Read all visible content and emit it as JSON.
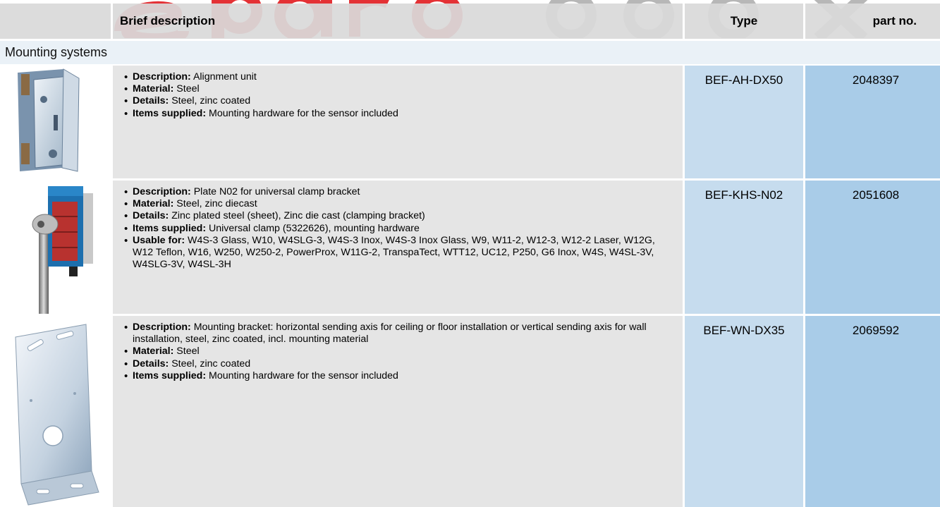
{
  "colors": {
    "header_bg": "#d9d9d9",
    "section_bg": "#eaf1f7",
    "description_bg": "#e5e5e5",
    "type_bg": "#c6dcee",
    "part_bg": "#a9cce8",
    "watermark_red": "#e3262b",
    "watermark_grey": "#b0b0b0"
  },
  "table": {
    "headers": {
      "image": "",
      "description": "Brief description",
      "type": "Type",
      "part_no": "part no."
    },
    "section": "Mounting systems",
    "rows": [
      {
        "image": "alignment-unit-photo",
        "type": "BEF-AH-DX50",
        "part_no": "2048397",
        "items": [
          {
            "label": "Description:",
            "value": " Alignment unit"
          },
          {
            "label": "Material:",
            "value": " Steel"
          },
          {
            "label": "Details:",
            "value": " Steel, zinc coated"
          },
          {
            "label": "Items supplied:",
            "value": " Mounting hardware for the sensor included"
          }
        ]
      },
      {
        "image": "clamp-bracket-photo",
        "type": "BEF-KHS-N02",
        "part_no": "2051608",
        "items": [
          {
            "label": "Description:",
            "value": " Plate N02 for universal clamp bracket"
          },
          {
            "label": "Material:",
            "value": " Steel, zinc diecast"
          },
          {
            "label": "Details:",
            "value": " Zinc plated steel (sheet), Zinc die cast (clamping bracket)"
          },
          {
            "label": "Items supplied:",
            "value": " Universal clamp (5322626), mounting hardware"
          },
          {
            "label": "Usable for:",
            "value": " W4S-3 Glass, W10, W4SLG-3, W4S-3 Inox, W4S-3 Inox Glass, W9, W11-2, W12-3, W12-2 Laser, W12G, W12 Teflon, W16, W250, W250-2, PowerProx, W11G-2, TranspaTect, WTT12, UC12, P250, G6 Inox, W4S, W4SL-3V, W4SLG-3V, W4SL-3H"
          }
        ]
      },
      {
        "image": "mounting-bracket-photo",
        "type": "BEF-WN-DX35",
        "part_no": "2069592",
        "items": [
          {
            "label": "Description:",
            "value": " Mounting bracket: horizontal sending axis for ceiling or floor installation or vertical sending axis for wall installation, steel, zinc coated, incl. mounting material"
          },
          {
            "label": "Material:",
            "value": " Steel"
          },
          {
            "label": "Details:",
            "value": " Steel, zinc coated"
          },
          {
            "label": "Items supplied:",
            "value": " Mounting hardware for the sensor included"
          }
        ]
      }
    ]
  }
}
